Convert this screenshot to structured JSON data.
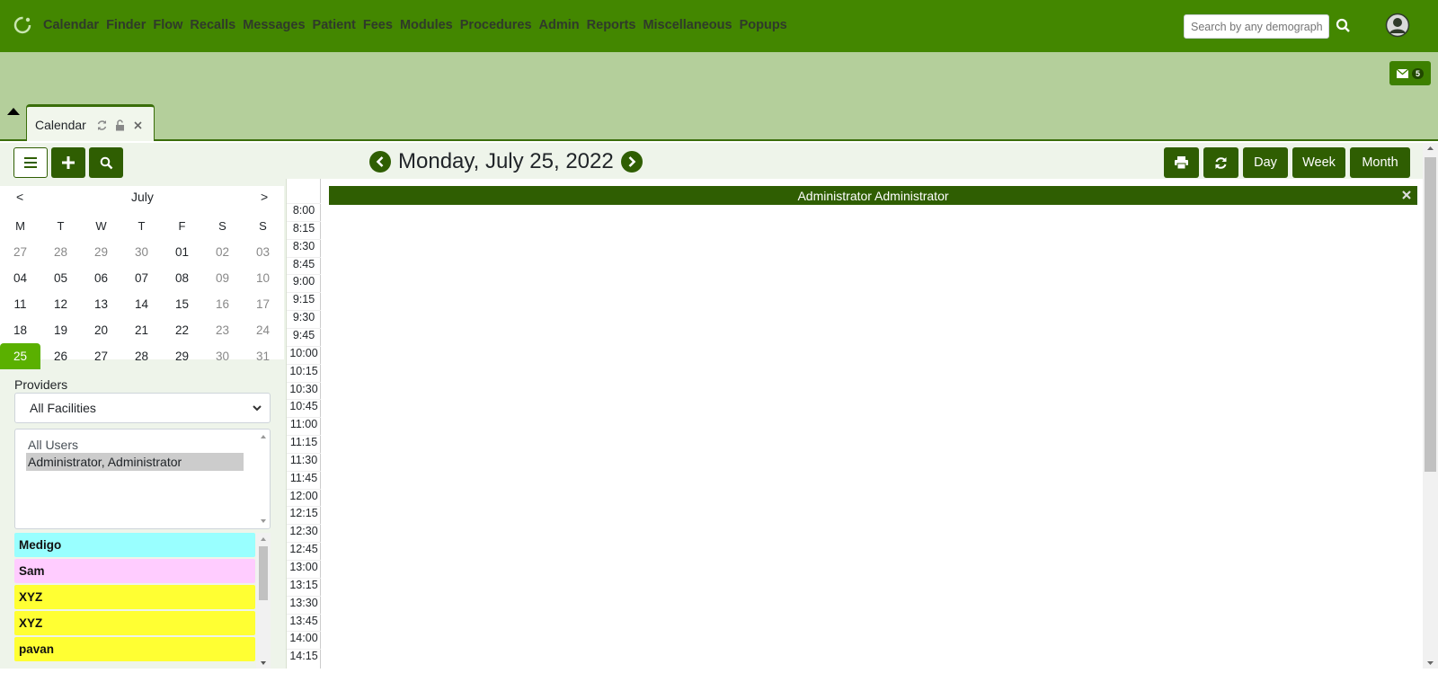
{
  "nav": {
    "menu": [
      "Calendar",
      "Finder",
      "Flow",
      "Recalls",
      "Messages",
      "Patient",
      "Fees",
      "Modules",
      "Procedures",
      "Admin",
      "Reports",
      "Miscellaneous",
      "Popups"
    ],
    "search_placeholder": "Search by any demographics",
    "icons": {
      "logo": "refresh-logo-icon",
      "search": "search-icon",
      "avatar": "user-avatar-icon"
    }
  },
  "band": {
    "messages_count": "5",
    "tab_label": "Calendar"
  },
  "toolbar": {
    "date_title": "Monday, July 25, 2022",
    "view_buttons": [
      "Day",
      "Week",
      "Month"
    ]
  },
  "mini_calendar": {
    "prev": "<",
    "month": "July",
    "next": ">",
    "weekdays": [
      "M",
      "T",
      "W",
      "T",
      "F",
      "S",
      "S"
    ],
    "weeks": [
      [
        "27",
        "28",
        "29",
        "30",
        "01",
        "02",
        "03"
      ],
      [
        "04",
        "05",
        "06",
        "07",
        "08",
        "09",
        "10"
      ],
      [
        "11",
        "12",
        "13",
        "14",
        "15",
        "16",
        "17"
      ],
      [
        "18",
        "19",
        "20",
        "21",
        "22",
        "23",
        "24"
      ],
      [
        "25",
        "26",
        "27",
        "28",
        "29",
        "30",
        "31"
      ]
    ],
    "selected_day": "25"
  },
  "sidebar": {
    "providers_label": "Providers",
    "facility_select": "All Facilities",
    "users": [
      "All Users",
      "Administrator, Administrator"
    ],
    "categories": [
      {
        "label": "Medigo",
        "color": "#99ffff"
      },
      {
        "label": "Sam",
        "color": "#ffccff"
      },
      {
        "label": "XYZ",
        "color": "#ffff33"
      },
      {
        "label": "XYZ",
        "color": "#ffff33"
      },
      {
        "label": "pavan",
        "color": "#ffff33"
      }
    ]
  },
  "schedule": {
    "provider": "Administrator Administrator",
    "times": [
      "8:00",
      "8:15",
      "8:30",
      "8:45",
      "9:00",
      "9:15",
      "9:30",
      "9:45",
      "10:00",
      "10:15",
      "10:30",
      "10:45",
      "11:00",
      "11:15",
      "11:30",
      "11:45",
      "12:00",
      "12:15",
      "12:30",
      "12:45",
      "13:00",
      "13:15",
      "13:30",
      "13:45",
      "14:00",
      "14:15"
    ]
  },
  "colors": {
    "nav_bg": "#438700",
    "band_bg": "#b4cf9b",
    "accent_dark": "#2f5e02",
    "today": "#5ab000"
  }
}
